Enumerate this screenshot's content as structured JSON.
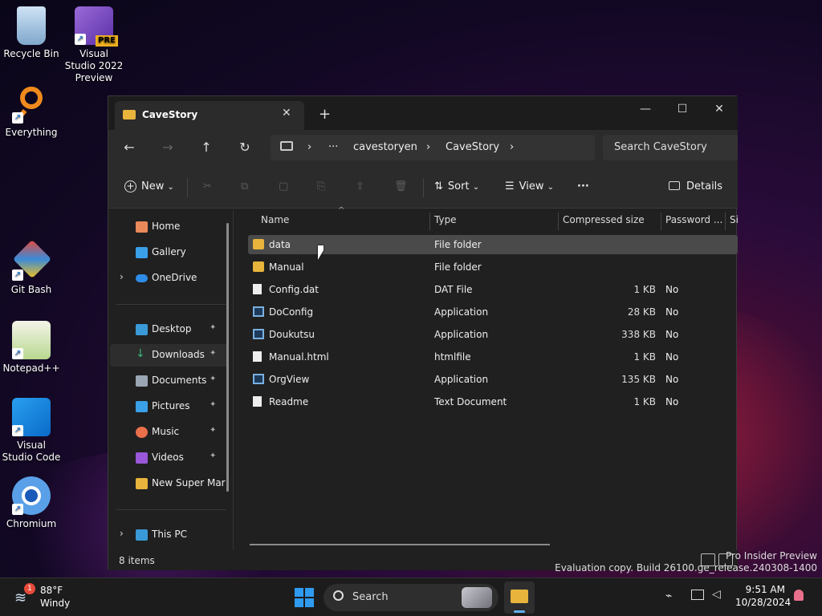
{
  "desktop": {
    "icons": [
      {
        "label": "Recycle Bin"
      },
      {
        "label": "Visual Studio 2022 Preview",
        "badge": "PRE"
      },
      {
        "label": "Everything"
      },
      {
        "label": "Git Bash"
      },
      {
        "label": "Notepad++"
      },
      {
        "label": "Visual Studio Code"
      },
      {
        "label": "Chromium"
      }
    ],
    "watermark_line1": "Pro Insider Preview",
    "watermark_line2": "Evaluation copy. Build 26100.ge_release.240308-1400"
  },
  "window": {
    "tab_title": "CaveStory",
    "tab_close": "✕",
    "new_tab": "+",
    "controls": {
      "minimize": "—",
      "maximize": "☐",
      "close": "✕"
    },
    "nav": {
      "back": "←",
      "forward": "→",
      "up": "↑",
      "refresh": "↻"
    },
    "address": {
      "chevron": "›",
      "ellipsis": "···",
      "segments": [
        "cavestoryen",
        "CaveStory"
      ]
    },
    "search_placeholder": "Search CaveStory",
    "toolbar": {
      "new_label": "New",
      "sort_label": "Sort",
      "view_label": "View",
      "more_label": "···",
      "details_label": "Details",
      "dropdown": "⌄"
    },
    "sidebar": {
      "items": [
        {
          "label": "Home",
          "color": "#e98a5a"
        },
        {
          "label": "Gallery",
          "color": "#3aa0e8"
        },
        {
          "label": "OneDrive",
          "color": "#2e8ce8",
          "expander": "›"
        },
        {
          "label": "Desktop",
          "color": "#3a9ad8",
          "pinned": true
        },
        {
          "label": "Downloads",
          "color": "#3ab87a",
          "pinned": true,
          "selected": true
        },
        {
          "label": "Documents",
          "color": "#9aa6b4",
          "pinned": true
        },
        {
          "label": "Pictures",
          "color": "#3aa0e8",
          "pinned": true
        },
        {
          "label": "Music",
          "color": "#e8704a",
          "pinned": true
        },
        {
          "label": "Videos",
          "color": "#9a58d8",
          "pinned": true
        },
        {
          "label": "New Super Mari",
          "color": "#e8b43c"
        },
        {
          "label": "This PC",
          "color": "#3a9ad8",
          "expander": "›"
        }
      ],
      "pin_glyph": "📌"
    },
    "columns": [
      "Name",
      "Type",
      "Compressed size",
      "Password ...",
      "Si"
    ],
    "sort_arrow": "^",
    "files": [
      {
        "name": "data",
        "type": "File folder",
        "size": "",
        "password": "",
        "icon": "folder",
        "selected": true
      },
      {
        "name": "Manual",
        "type": "File folder",
        "size": "",
        "password": "",
        "icon": "folder"
      },
      {
        "name": "Config.dat",
        "type": "DAT File",
        "size": "1 KB",
        "password": "No",
        "icon": "file"
      },
      {
        "name": "DoConfig",
        "type": "Application",
        "size": "28 KB",
        "password": "No",
        "icon": "app"
      },
      {
        "name": "Doukutsu",
        "type": "Application",
        "size": "338 KB",
        "password": "No",
        "icon": "app"
      },
      {
        "name": "Manual.html",
        "type": "htmlfile",
        "size": "1 KB",
        "password": "No",
        "icon": "file"
      },
      {
        "name": "OrgView",
        "type": "Application",
        "size": "135 KB",
        "password": "No",
        "icon": "app"
      },
      {
        "name": "Readme",
        "type": "Text Document",
        "size": "1 KB",
        "password": "No",
        "icon": "file"
      }
    ],
    "status": "8 items"
  },
  "taskbar": {
    "weather_temp": "88°F",
    "weather_desc": "Windy",
    "weather_badge": "1",
    "search_label": "Search",
    "time": "9:51 AM",
    "date": "10/28/2024"
  },
  "colors": {
    "folder": "#e8b43c",
    "accent": "#2e8ce8",
    "selection": "#4a4a4a"
  }
}
